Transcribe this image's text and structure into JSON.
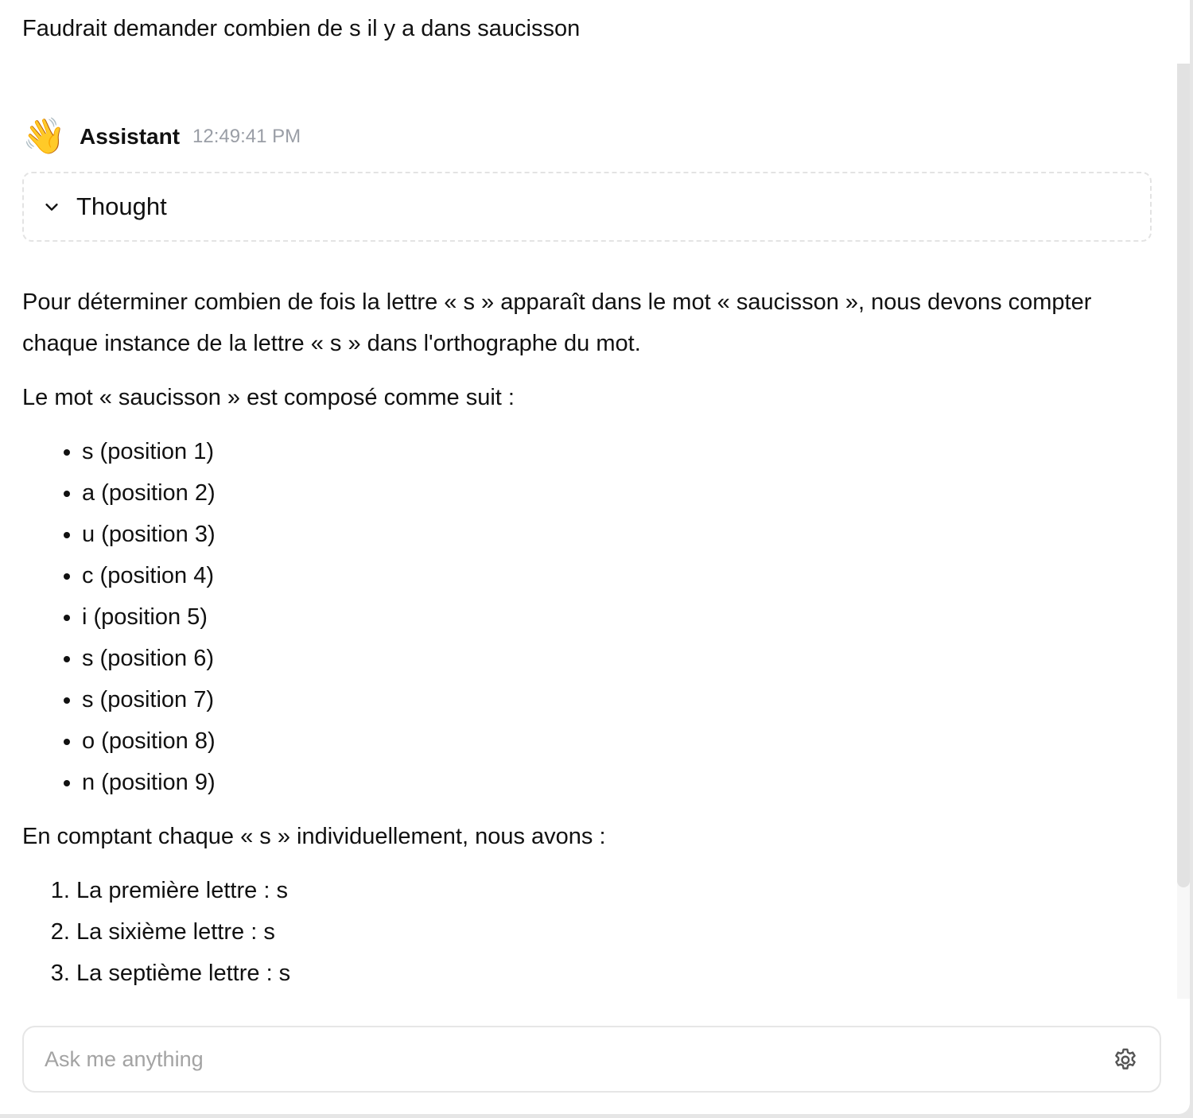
{
  "user_message": "Faudrait demander combien de s il y a dans saucisson",
  "assistant": {
    "avatar_emoji": "👋",
    "name": "Assistant",
    "timestamp": "12:49:41 PM",
    "thought_label": "Thought",
    "intro": "Pour déterminer combien de fois la lettre « s » apparaît dans le mot « saucisson », nous devons compter chaque instance de la lettre « s » dans l'orthographe du mot.",
    "composition_intro": "Le mot « saucisson » est composé comme suit :",
    "letters": [
      "s (position 1)",
      "a (position 2)",
      "u (position 3)",
      "c (position 4)",
      "i (position 5)",
      "s (position 6)",
      "s (position 7)",
      "o (position 8)",
      "n (position 9)"
    ],
    "count_intro": "En comptant chaque « s » individuellement, nous avons :",
    "counted": [
      "La première lettre : s",
      "La sixième lettre : s",
      "La septième lettre : s"
    ]
  },
  "input": {
    "placeholder": "Ask me anything",
    "value": ""
  },
  "icons": {
    "settings": "gear-icon",
    "thought_toggle": "chevron-down-icon"
  }
}
